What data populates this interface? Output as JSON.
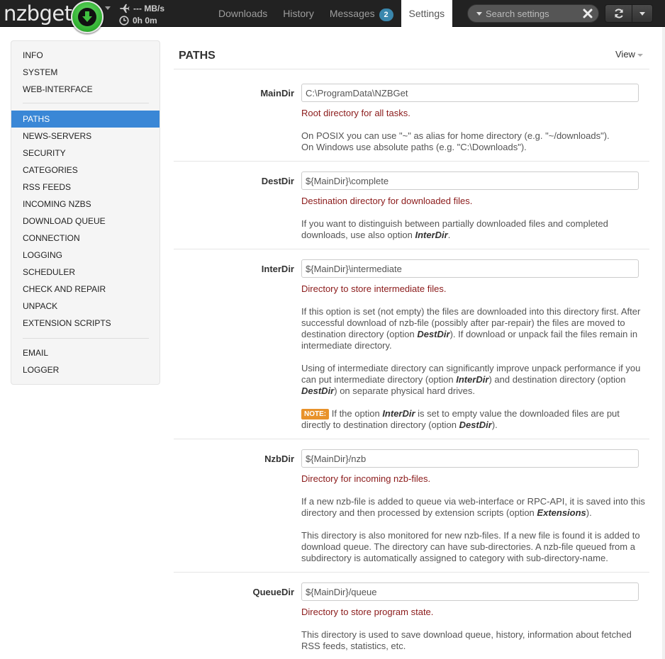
{
  "brand": {
    "name": "nzbget"
  },
  "stats": {
    "speed": "--- MB/s",
    "time_left": "0h 0m"
  },
  "nav": {
    "tabs": [
      {
        "label": "Downloads"
      },
      {
        "label": "History"
      },
      {
        "label": "Messages",
        "badge": "2"
      },
      {
        "label": "Settings",
        "active": true
      }
    ]
  },
  "search": {
    "placeholder": "Search settings"
  },
  "sidebar": {
    "items": [
      "INFO",
      "SYSTEM",
      "WEB-INTERFACE",
      "PATHS",
      "NEWS-SERVERS",
      "SECURITY",
      "CATEGORIES",
      "RSS FEEDS",
      "INCOMING NZBS",
      "DOWNLOAD QUEUE",
      "CONNECTION",
      "LOGGING",
      "SCHEDULER",
      "CHECK AND REPAIR",
      "UNPACK",
      "EXTENSION SCRIPTS",
      "EMAIL",
      "LOGGER"
    ],
    "active": "PATHS"
  },
  "main": {
    "title": "PATHS",
    "view_label": "View",
    "options": [
      {
        "name": "MainDir",
        "value": "C:\\ProgramData\\NZBGet",
        "summary": "Root directory for all tasks.",
        "desc1": "On POSIX you can use \"~\" as alias for home directory (e.g. \"~/downloads\").",
        "desc2": "On Windows use absolute paths (e.g. \"C:\\Downloads\")."
      },
      {
        "name": "DestDir",
        "value": "${MainDir}\\complete",
        "summary": "Destination directory for downloaded files.",
        "desc1a": "If you want to distinguish between partially downloaded files and completed",
        "desc1b": "downloads, use also option",
        "desc1b_em": "InterDir",
        "desc1b_end": "."
      },
      {
        "name": "InterDir",
        "value": "${MainDir}\\intermediate",
        "summary": "Directory to store intermediate files.",
        "p1_l1": "If this option is set (not empty) the files are downloaded into this directory first. After",
        "p1_l2": "successful download of nzb-file (possibly after par-repair) the files are moved to",
        "p1_l3a": "destination directory (option",
        "p1_l3_em": "DestDir",
        "p1_l3b": "). If download or unpack fail the files remain in",
        "p1_l4": "intermediate directory.",
        "p2_l1": "Using of intermediate directory can significantly improve unpack performance if you",
        "p2_l2a": "can put intermediate directory (option",
        "p2_l2_em": "InterDir",
        "p2_l2b": ") and destination directory (option",
        "p2_l3_em": "DestDir",
        "p2_l3b": ") on separate physical hard drives.",
        "note_label": "NOTE:",
        "note_l1a": "If the option",
        "note_l1_em": "InterDir",
        "note_l1b": "is set to empty value the downloaded files are put",
        "note_l2a": "directly to destination directory (option",
        "note_l2_em": "DestDir",
        "note_l2b": ")."
      },
      {
        "name": "NzbDir",
        "value": "${MainDir}/nzb",
        "summary": "Directory for incoming nzb-files.",
        "p1_l1": "If a new nzb-file is added to queue via web-interface or RPC-API, it is saved into this",
        "p1_l2a": "directory and then processed by extension scripts (option",
        "p1_l2_em": "Extensions",
        "p1_l2b": ").",
        "p2_l1": "This directory is also monitored for new nzb-files. If a new file is found it is added to",
        "p2_l2": "download queue. The directory can have sub-directories. A nzb-file queued from a",
        "p2_l3": "subdirectory is automatically assigned to category with sub-directory-name."
      },
      {
        "name": "QueueDir",
        "value": "${MainDir}/queue",
        "summary": "Directory to store program state.",
        "p1_l1": "This directory is used to save download queue, history, information about fetched",
        "p1_l2": "RSS feeds, statistics, etc."
      }
    ]
  }
}
